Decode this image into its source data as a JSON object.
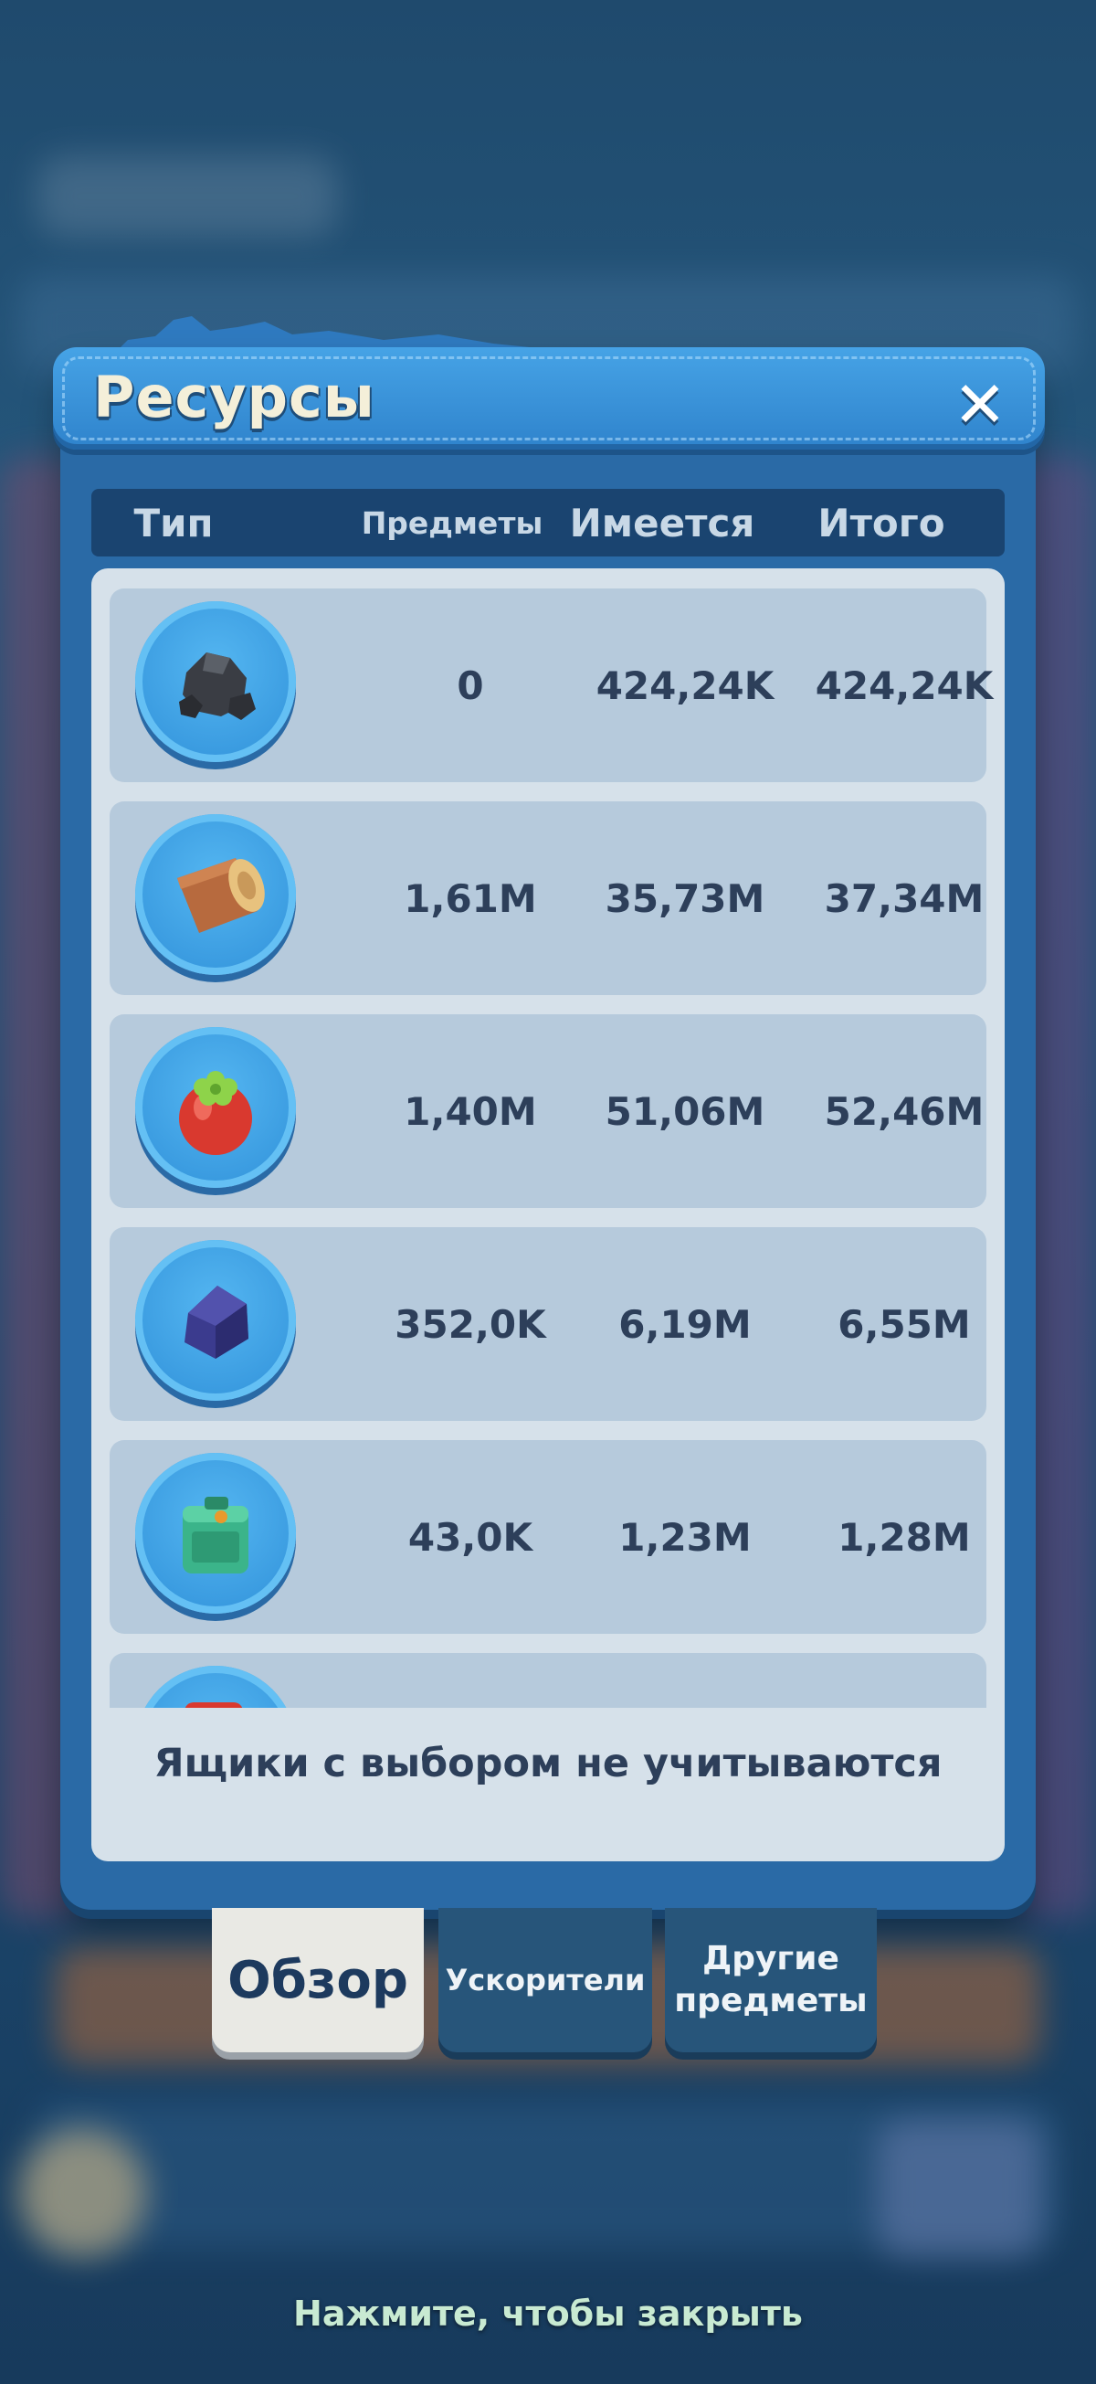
{
  "dialog": {
    "title": "Ресурсы",
    "close_icon": "close-icon"
  },
  "columns": {
    "type": "Тип",
    "items": "Предметы",
    "have": "Имеется",
    "total": "Итого"
  },
  "rows": [
    {
      "icon": "coal-icon",
      "items": "0",
      "have": "424,24K",
      "total": "424,24K"
    },
    {
      "icon": "wood-log-icon",
      "items": "1,61M",
      "have": "35,73M",
      "total": "37,34M"
    },
    {
      "icon": "fruit-food-icon",
      "items": "1,40M",
      "have": "51,06M",
      "total": "52,46M"
    },
    {
      "icon": "blue-crystal-icon",
      "items": "352,0K",
      "have": "6,19M",
      "total": "6,55M"
    },
    {
      "icon": "green-canister-icon",
      "items": "43,0K",
      "have": "1,23M",
      "total": "1,28M"
    },
    {
      "icon": "red-item-icon",
      "items": "",
      "have": "",
      "total": ""
    }
  ],
  "footnote": "Ящики с выбором не учитываются",
  "tabs": {
    "overview": "Обзор",
    "boosters": "Ускорители",
    "other_line1": "Другие",
    "other_line2": "предметы"
  },
  "tap_to_close": "Нажмите, чтобы закрыть"
}
